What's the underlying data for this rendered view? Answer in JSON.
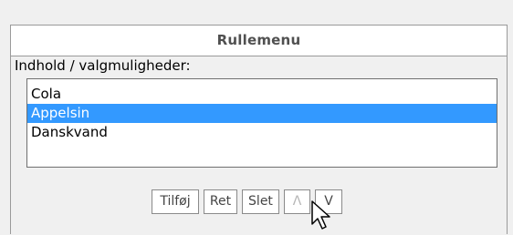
{
  "panel": {
    "title": "Rullemenu",
    "section_label": "Indhold / valgmuligheder:"
  },
  "list": {
    "items": [
      {
        "label": "Cola",
        "selected": false
      },
      {
        "label": "Appelsin",
        "selected": true
      },
      {
        "label": "Danskvand",
        "selected": false
      }
    ],
    "selected_color": "#3399ff"
  },
  "buttons": {
    "add_label": "Tilføj",
    "edit_label": "Ret",
    "delete_label": "Slet",
    "up_label": "Λ",
    "down_label": "V"
  },
  "cursor": {
    "icon": "arrow-pointer-icon"
  }
}
